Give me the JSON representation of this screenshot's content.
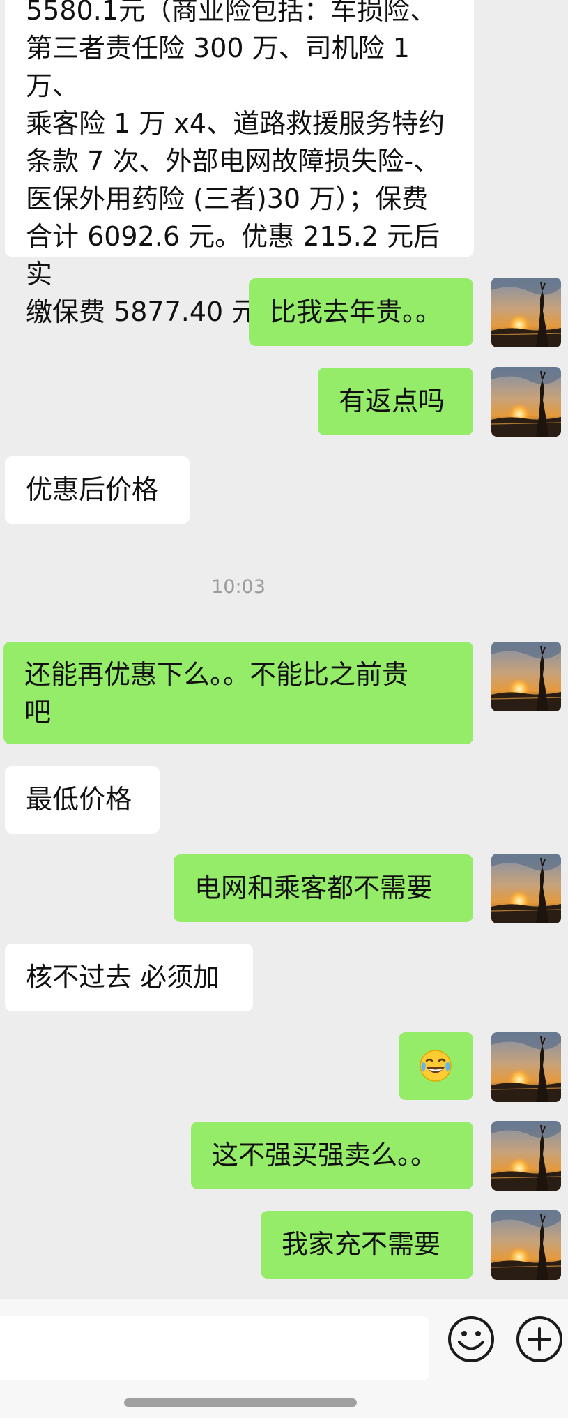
{
  "chat": {
    "messages": [
      {
        "side": "in",
        "lines": [
          "5580.1元（商业险包括：车损险、",
          "第三者责任险 300 万、司机险 1 万、",
          "乘客险 1 万 x4、道路救援服务特约",
          "条款 7 次、外部电网故障损失险-、",
          "医保外用药险 (三者)30 万）；保费",
          "合计 6092.6 元。优惠 215.2 元后实",
          "缴保费 5877.40 元。"
        ]
      },
      {
        "side": "out",
        "text": "比我去年贵。。"
      },
      {
        "side": "out",
        "text": "有返点吗"
      },
      {
        "side": "in",
        "text": "优惠后价格"
      },
      {
        "side": "out",
        "lines": [
          "还能再优惠下么。。不能比之前贵",
          "吧"
        ]
      },
      {
        "side": "in",
        "text": "最低价格"
      },
      {
        "side": "out",
        "text": "电网和乘客都不需要"
      },
      {
        "side": "in",
        "text": "核不过去 必须加"
      },
      {
        "side": "out",
        "emoji": "face-with-tears-of-joy"
      },
      {
        "side": "out",
        "text": "这不强买强卖么。。"
      },
      {
        "side": "out",
        "text": "我家充不需要"
      }
    ],
    "timestamp": "10:03"
  },
  "input_bar": {
    "emoji_icon": "smiley-face-icon",
    "plus_icon": "plus-circle-icon"
  },
  "colors": {
    "outgoing_bubble": "#95ec69",
    "incoming_bubble": "#ffffff",
    "background": "#ededed"
  }
}
